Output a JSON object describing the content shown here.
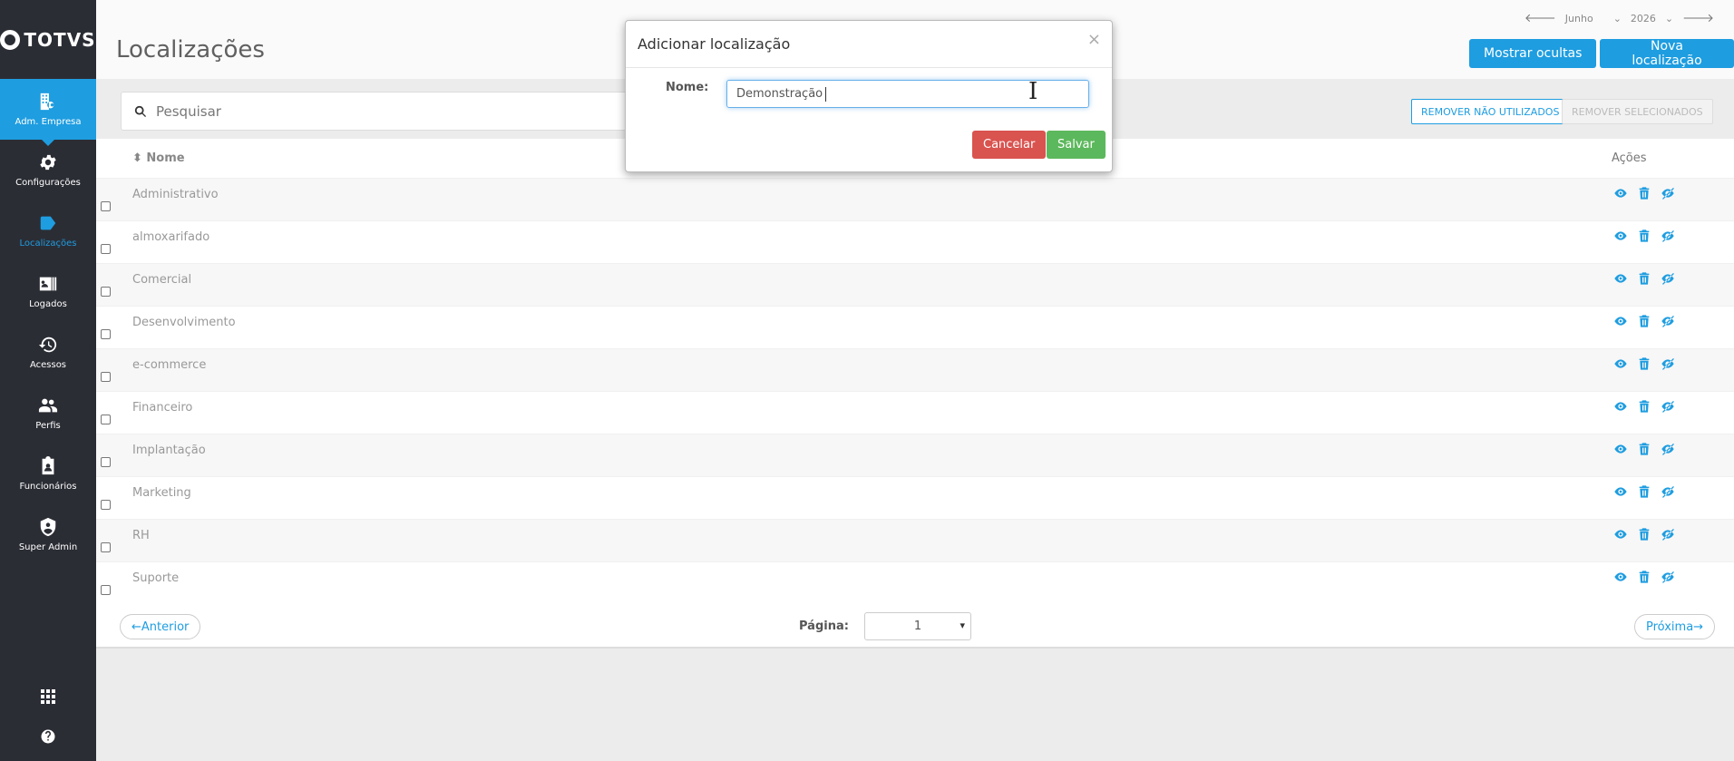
{
  "brand": {
    "logo_text": "TOTVS"
  },
  "sidebar": {
    "items": [
      {
        "label": "Adm. Empresa",
        "icon": "building-gear-icon"
      },
      {
        "label": "Configurações",
        "icon": "gear-icon"
      },
      {
        "label": "Localizações",
        "icon": "tag-icon"
      },
      {
        "label": "Logados",
        "icon": "id-card-icon"
      },
      {
        "label": "Acessos",
        "icon": "history-icon"
      },
      {
        "label": "Perfis",
        "icon": "users-icon"
      },
      {
        "label": "Funcionários",
        "icon": "clipboard-user-icon"
      },
      {
        "label": "Super Admin",
        "icon": "shield-user-icon"
      }
    ],
    "bottom_icons": [
      "apps-grid-icon",
      "help-icon"
    ]
  },
  "header": {
    "title": "Localizações",
    "month": "Junho",
    "year": "2026",
    "show_hidden_label": "Mostrar ocultas",
    "new_location_label": "Nova localização"
  },
  "toolbar": {
    "search_placeholder": "Pesquisar",
    "remove_unused_label": "REMOVER NÃO UTILIZADOS",
    "remove_selected_label": "REMOVER SELECIONADOS"
  },
  "table": {
    "col_name": "Nome",
    "col_actions": "Ações",
    "rows": [
      "Administrativo",
      "almoxarifado",
      "Comercial",
      "Desenvolvimento",
      "e-commerce",
      "Financeiro",
      "Implantação",
      "Marketing",
      "RH",
      "Suporte"
    ]
  },
  "pagination": {
    "prev_label": "←Anterior",
    "page_label": "Página:",
    "page_value": "1",
    "next_label": "Próxima→"
  },
  "modal": {
    "title": "Adicionar localização",
    "close": "×",
    "name_label": "Nome:",
    "name_value": "Demonstração ",
    "cancel_label": "Cancelar",
    "save_label": "Salvar"
  },
  "colors": {
    "accent": "#1e9de0",
    "sidebar": "#2b2d35",
    "danger": "#d9534f",
    "success": "#5cb85c"
  }
}
